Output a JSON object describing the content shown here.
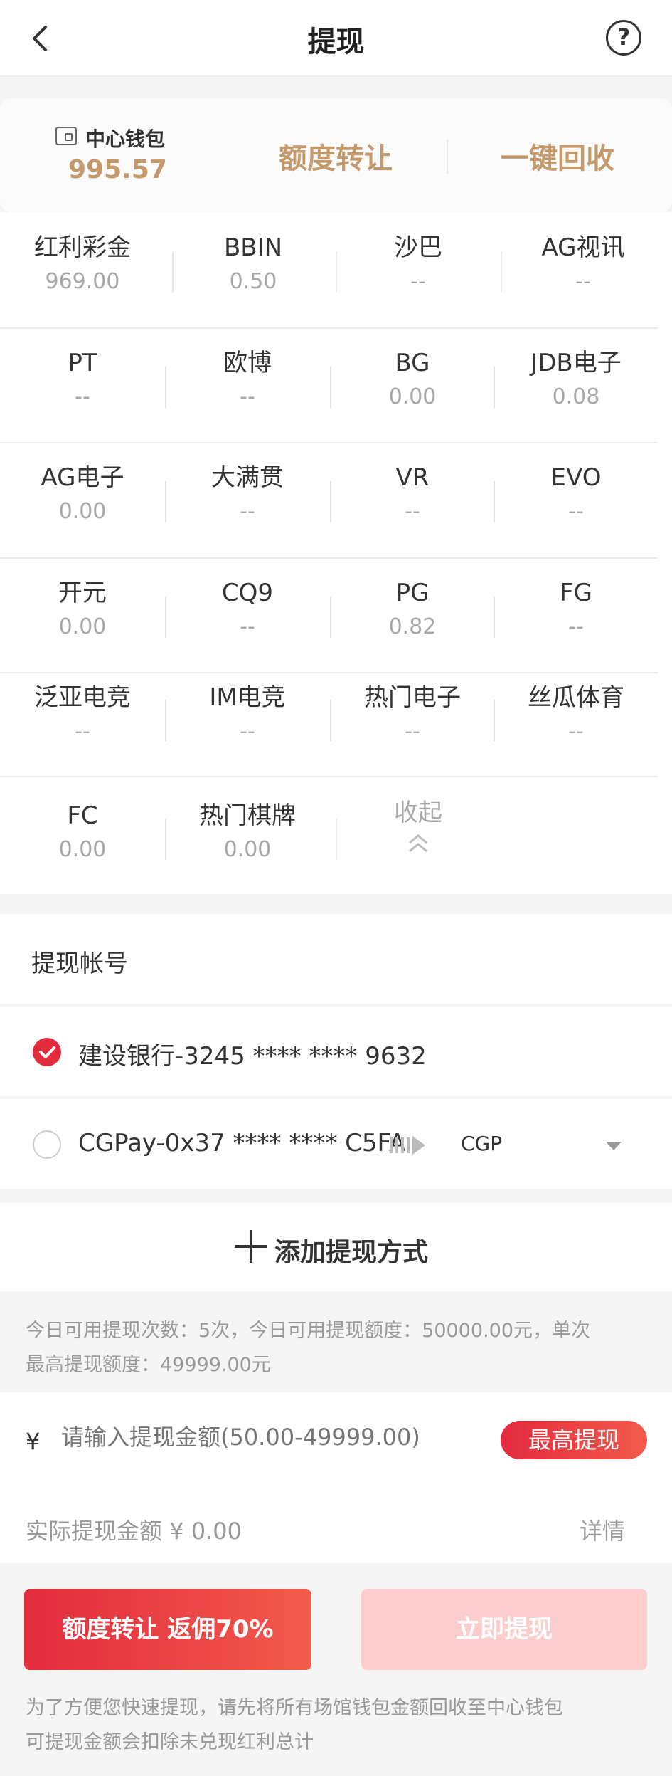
{
  "header": {
    "title": "提现",
    "help_label": "?"
  },
  "wallet": {
    "label": "中心钱包",
    "amount": "995.57",
    "transfer_label": "额度转让",
    "recycle_label": "一键回收"
  },
  "venues": [
    {
      "name": "红利彩金",
      "value": "969.00"
    },
    {
      "name": "BBIN",
      "value": "0.50"
    },
    {
      "name": "沙巴",
      "value": "--"
    },
    {
      "name": "AG视讯",
      "value": "--"
    },
    {
      "name": "PT",
      "value": "--"
    },
    {
      "name": "欧博",
      "value": "--"
    },
    {
      "name": "BG",
      "value": "0.00"
    },
    {
      "name": "JDB电子",
      "value": "0.08"
    },
    {
      "name": "AG电子",
      "value": "0.00"
    },
    {
      "name": "大满贯",
      "value": "--"
    },
    {
      "name": "VR",
      "value": "--"
    },
    {
      "name": "EVO",
      "value": "--"
    },
    {
      "name": "开元",
      "value": "0.00"
    },
    {
      "name": "CQ9",
      "value": "--"
    },
    {
      "name": "PG",
      "value": "0.82"
    },
    {
      "name": "FG",
      "value": "--"
    },
    {
      "name": "泛亚电竞",
      "value": "--"
    },
    {
      "name": "IM电竞",
      "value": "--"
    },
    {
      "name": "热门电子",
      "value": "--"
    },
    {
      "name": "丝瓜体育",
      "value": "--"
    },
    {
      "name": "FC",
      "value": "0.00"
    },
    {
      "name": "热门棋牌",
      "value": "0.00"
    }
  ],
  "collapse_label": "收起",
  "accounts": {
    "title": "提现帐号",
    "items": [
      {
        "label": "建设银行-3245 **** **** 9632",
        "selected": true
      },
      {
        "label": "CGPay-0x37 **** **** C5FA",
        "selected": false,
        "currency": "CGP"
      }
    ],
    "add_label": "添加提现方式"
  },
  "info": {
    "line1": "今日可用提现次数：5次，今日可用提现额度：50000.00元，单次",
    "line2": "最高提现额度：49999.00元"
  },
  "amount": {
    "currency": "¥",
    "placeholder": "请输入提现金额(50.00-49999.00)",
    "max_label": "最高提现",
    "actual_label": "实际提现金额 ¥ 0.00",
    "detail_label": "详情"
  },
  "actions": {
    "transfer_label": "额度转让 返佣70%",
    "withdraw_label": "立即提现"
  },
  "note": {
    "line1": "为了方便您快速提现，请先将所有场馆钱包金额回收至中心钱包",
    "line2": "可提现金额会扣除未兑现红利总计"
  },
  "colors": {
    "accent": "#e32b3e",
    "gold": "#c49a6c",
    "disabled": "#fccdcd"
  }
}
